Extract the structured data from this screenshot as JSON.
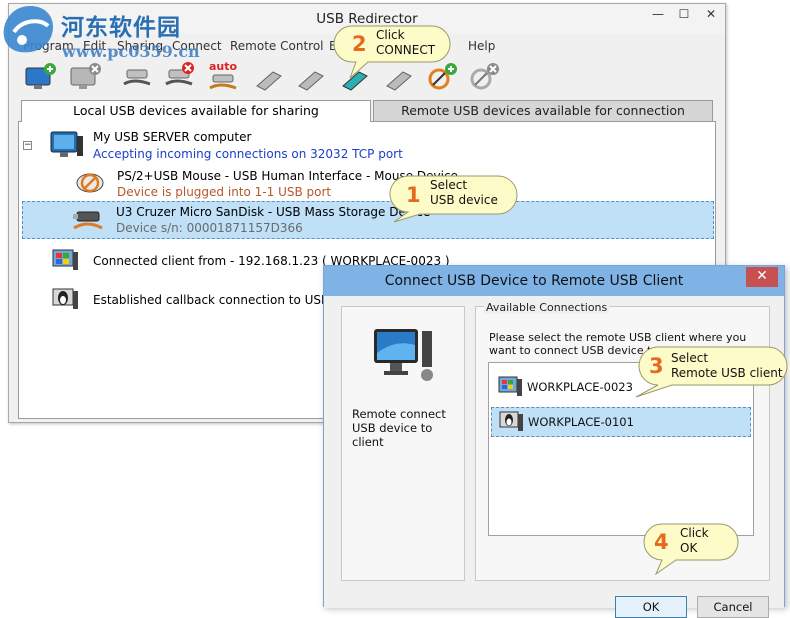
{
  "window": {
    "title": "USB Redirector",
    "min_glyph": "—",
    "max_glyph": "☐",
    "close_glyph": "✕"
  },
  "menu": {
    "items": [
      "Program",
      "Edit",
      "Sharing",
      "Connect",
      "Remote Control",
      "Ex",
      "Help"
    ]
  },
  "toolbar": {
    "auto_label": "auto"
  },
  "tabs": {
    "local": "Local USB devices available for sharing",
    "remote": "Remote USB devices available for connection"
  },
  "tree": {
    "expander": "−",
    "server": {
      "name": "My USB SERVER computer",
      "status": "Accepting incoming connections on 32032 TCP port"
    },
    "mouse": {
      "name": "PS/2+USB Mouse - USB Human Interface - Mouse Device",
      "status": "Device is plugged into 1-1 USB port"
    },
    "u3": {
      "name": "U3 Cruzer Micro SanDisk - USB Mass Storage Device",
      "status": "Device s/n: 00001871157D366"
    },
    "client": {
      "name": "Connected client from - 192.168.1.23 ( WORKPLACE-0023 )"
    },
    "callback": {
      "name": "Established callback connection to USB Redire"
    }
  },
  "callouts": [
    {
      "num": "1",
      "text": "Select\nUSB device"
    },
    {
      "num": "2",
      "text": "Click\nCONNECT"
    },
    {
      "num": "3",
      "text": "Select\nRemote USB client"
    },
    {
      "num": "4",
      "text": "Click\nOK"
    }
  ],
  "dialog": {
    "title": "Connect USB Device to Remote USB Client",
    "close_glyph": "✕",
    "left_caption": "Remote connect USB device to client",
    "group_legend": "Available Connections",
    "instruction": "Please select the remote USB client where you want to connect USB device to:",
    "connections": [
      "WORKPLACE-0023",
      "WORKPLACE-0101"
    ],
    "ok_label": "OK",
    "cancel_label": "Cancel"
  },
  "watermark": {
    "text": "河东软件园",
    "url": "www.pc0359.cn"
  },
  "colors": {
    "accent_blue": "#1a3fc9",
    "status_brown": "#b4582a",
    "selection": "#bfe0f7",
    "callout_fill": "#fdfbc8",
    "callout_number": "#e66a1c",
    "dialog_titlebar": "#7fb2e5"
  }
}
